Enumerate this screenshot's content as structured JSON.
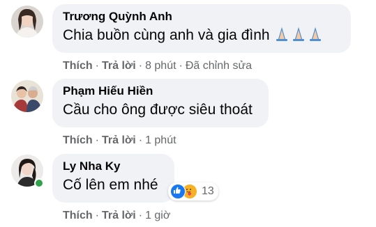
{
  "comments": [
    {
      "author": "Trương Quỳnh Anh",
      "text": "Chia buồn cùng anh và gia đình",
      "like_label": "Thích",
      "reply_label": "Trả lời",
      "time": "8 phút",
      "edited": "Đã chỉnh sửa",
      "emoji": "folded-hands-icon"
    },
    {
      "author": "Phạm Hiếu Hiền",
      "text": "Cầu cho ông được siêu thoát",
      "like_label": "Thích",
      "reply_label": "Trả lời",
      "time": "1 phút"
    },
    {
      "author": "Ly Nha Ky",
      "text": "Cố lên em nhé",
      "like_label": "Thích",
      "reply_label": "Trả lời",
      "time": "1 giờ",
      "online": true,
      "reactions": {
        "icons": [
          "like-icon",
          "care-icon"
        ],
        "count": "13"
      }
    }
  ],
  "colors": {
    "bubble": "#f0f2f5",
    "meta_text": "#65676b",
    "like_blue": "#1877f2",
    "online_green": "#31a24c"
  }
}
